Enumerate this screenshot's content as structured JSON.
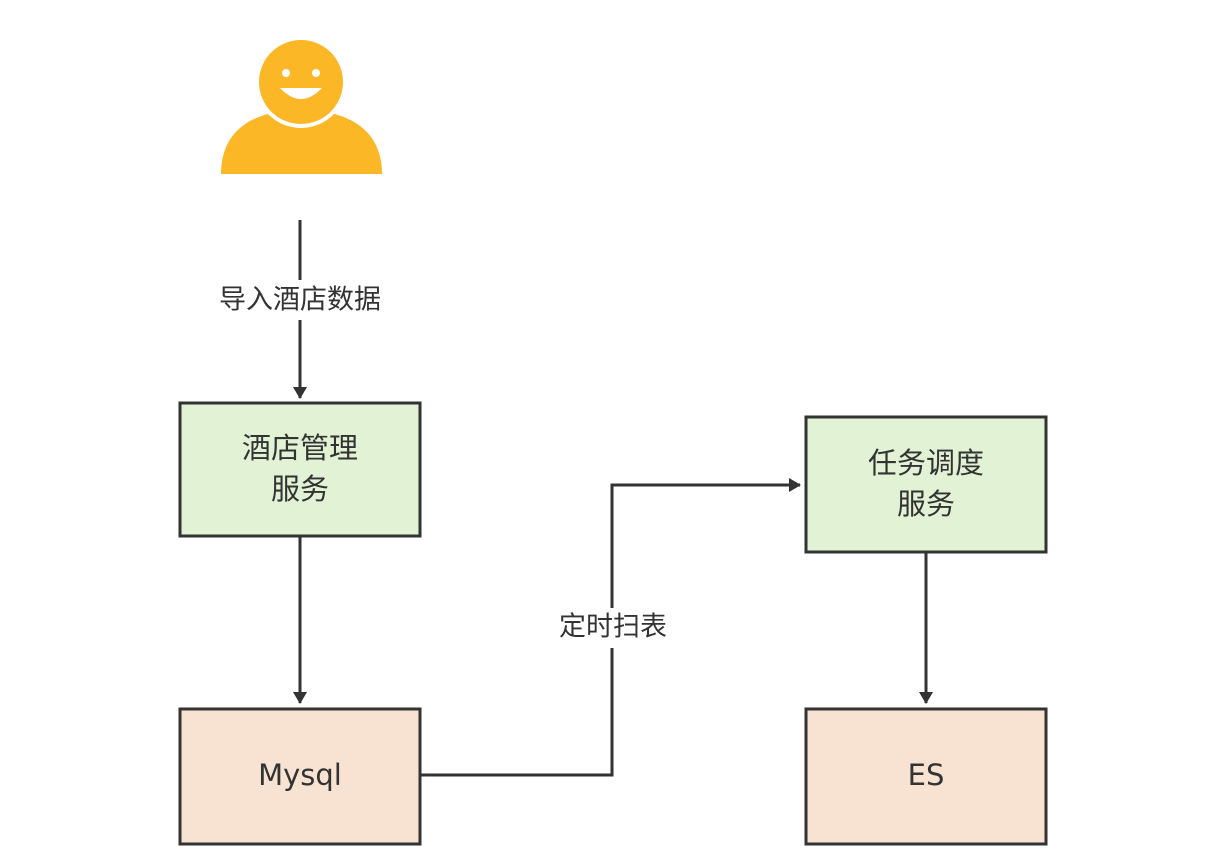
{
  "diagram": {
    "actor": {
      "icon": "smiling-user-icon",
      "color": "#FBB725"
    },
    "nodes": {
      "hotel_mgmt": {
        "line1": "酒店管理",
        "line2": "服务",
        "fill": "#E2F2D5",
        "stroke": "#333333"
      },
      "task_sched": {
        "line1": "任务调度",
        "line2": "服务",
        "fill": "#E2F2D5",
        "stroke": "#333333"
      },
      "mysql": {
        "label": "Mysql",
        "fill": "#F8E3D3",
        "stroke": "#333333"
      },
      "es": {
        "label": "ES",
        "fill": "#F8E3D3",
        "stroke": "#333333"
      }
    },
    "edges": {
      "import_label": "导入酒店数据",
      "scan_label": "定时扫表"
    },
    "edge_color": "#333333"
  }
}
